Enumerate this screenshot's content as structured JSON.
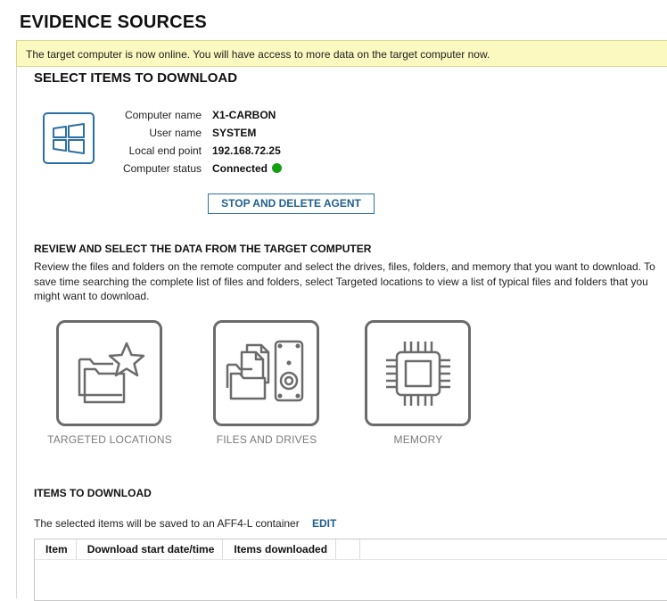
{
  "page": {
    "title": "EVIDENCE SOURCES",
    "banner": "The target computer is now online. You will have access to more data on the target computer now."
  },
  "select_section": {
    "heading": "SELECT ITEMS TO DOWNLOAD",
    "icon": "windows-logo-icon",
    "computer_info": [
      {
        "label": "Computer name",
        "value": "X1-CARBON"
      },
      {
        "label": "User name",
        "value": "SYSTEM"
      },
      {
        "label": "Local end point",
        "value": "192.168.72.25"
      },
      {
        "label": "Computer status",
        "value": "Connected"
      }
    ],
    "status_color": "#12a012",
    "stop_button": "STOP AND DELETE AGENT"
  },
  "review_section": {
    "heading": "REVIEW AND SELECT THE DATA FROM THE TARGET COMPUTER",
    "description": "Review the files and folders on the remote computer and select the drives, files, folders, and memory that you want to download. To save time searching the complete list of files and folders, select Targeted locations to view a list of typical files and folders that you might want to download.",
    "options": [
      {
        "label": "TARGETED LOCATIONS",
        "icon": "folder-star-icon"
      },
      {
        "label": "FILES AND DRIVES",
        "icon": "files-and-drive-icon"
      },
      {
        "label": "MEMORY",
        "icon": "memory-chip-icon"
      }
    ]
  },
  "items_section": {
    "heading": "ITEMS TO DOWNLOAD",
    "save_text": "The selected items will be saved to an AFF4-L container",
    "edit_link": "EDIT",
    "columns": [
      "Item",
      "Download start date/time",
      "Items downloaded"
    ]
  },
  "colors": {
    "accent": "#1f5f8f",
    "banner_bg": "#fbf8c0",
    "tile_border": "#6b6b6b"
  }
}
